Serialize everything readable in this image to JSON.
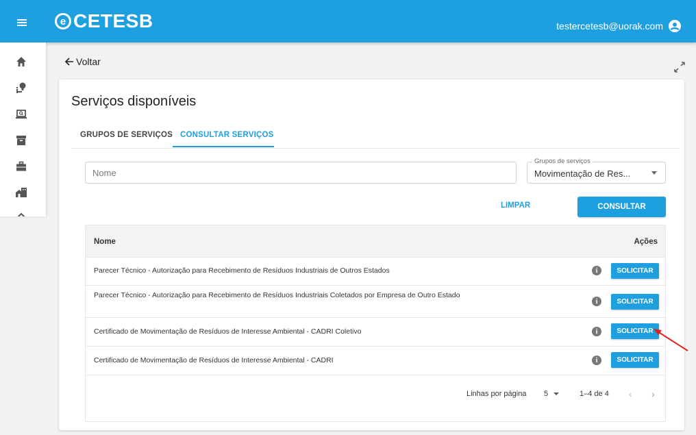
{
  "header": {
    "logo_mark": "e",
    "logo_text": "CETESB",
    "user_email": "testercetesb@uorak.com",
    "accent_color": "#1e9fe0"
  },
  "sidebar": {
    "icons": [
      "home-icon",
      "lightbulb-person-icon",
      "laptop-search-icon",
      "archive-icon",
      "briefcase-icon",
      "building-icon"
    ]
  },
  "nav": {
    "back_label": "Voltar"
  },
  "card": {
    "title": "Serviços disponíveis",
    "tabs": [
      {
        "label": "GRUPOS DE SERVIÇOS",
        "active": false
      },
      {
        "label": "CONSULTAR SERVIÇOS",
        "active": true
      }
    ]
  },
  "filters": {
    "name_placeholder": "Nome",
    "group_label": "Grupos de serviços",
    "group_value": "Movimentação de Res...",
    "clear_label": "LIMPAR",
    "search_label": "CONSULTAR"
  },
  "table": {
    "columns": [
      "Nome",
      "Ações"
    ],
    "rows": [
      {
        "name": "Parecer Técnico - Autorização para Recebimento de Resíduos Industriais de Outros Estados",
        "action": "SOLICITAR"
      },
      {
        "name": "Parecer Técnico - Autorização para Recebimento de Resíduos Industriais Coletados por Empresa de Outro Estado",
        "action": "SOLICITAR"
      },
      {
        "name": "Certificado de Movimentação de Resíduos de Interesse Ambiental - CADRI Coletivo",
        "action": "SOLICITAR"
      },
      {
        "name": "Certificado de Movimentação de Resíduos de Interesse Ambiental - CADRI",
        "action": "SOLICITAR"
      }
    ],
    "info_glyph": "i"
  },
  "pagination": {
    "rows_per_page_label": "Linhas por página",
    "rows_per_page_value": "5",
    "range": "1–4 de 4",
    "prev": "‹",
    "next": "›"
  }
}
